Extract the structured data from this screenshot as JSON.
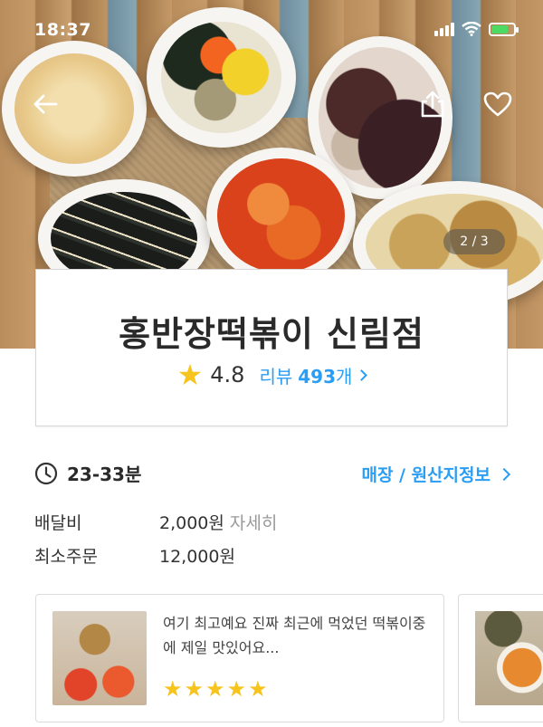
{
  "status_bar": {
    "time": "18:37"
  },
  "hero": {
    "page_indicator": "2 / 3",
    "icons": [
      "back-arrow-icon",
      "share-icon",
      "heart-icon"
    ]
  },
  "store": {
    "name": "홍반장떡볶이 신림점",
    "rating": "4.8",
    "review_prefix": "리뷰",
    "review_count": "493",
    "review_suffix": "개"
  },
  "info": {
    "delivery_time": "23-33분",
    "origin_link": "매장 / 원산지정보",
    "delivery_fee_label": "배달비",
    "delivery_fee_value": "2,000원",
    "delivery_fee_detail": "자세히",
    "min_order_label": "최소주문",
    "min_order_value": "12,000원"
  },
  "reviews": [
    {
      "text": "여기 최고예요 진짜 최근에 먹었던 떡볶이중에 제일 맛있어요...",
      "stars": 5
    },
    {
      "text": "",
      "stars": 0
    }
  ],
  "colors": {
    "accent": "#2a9df4",
    "star": "#f6c41d"
  }
}
